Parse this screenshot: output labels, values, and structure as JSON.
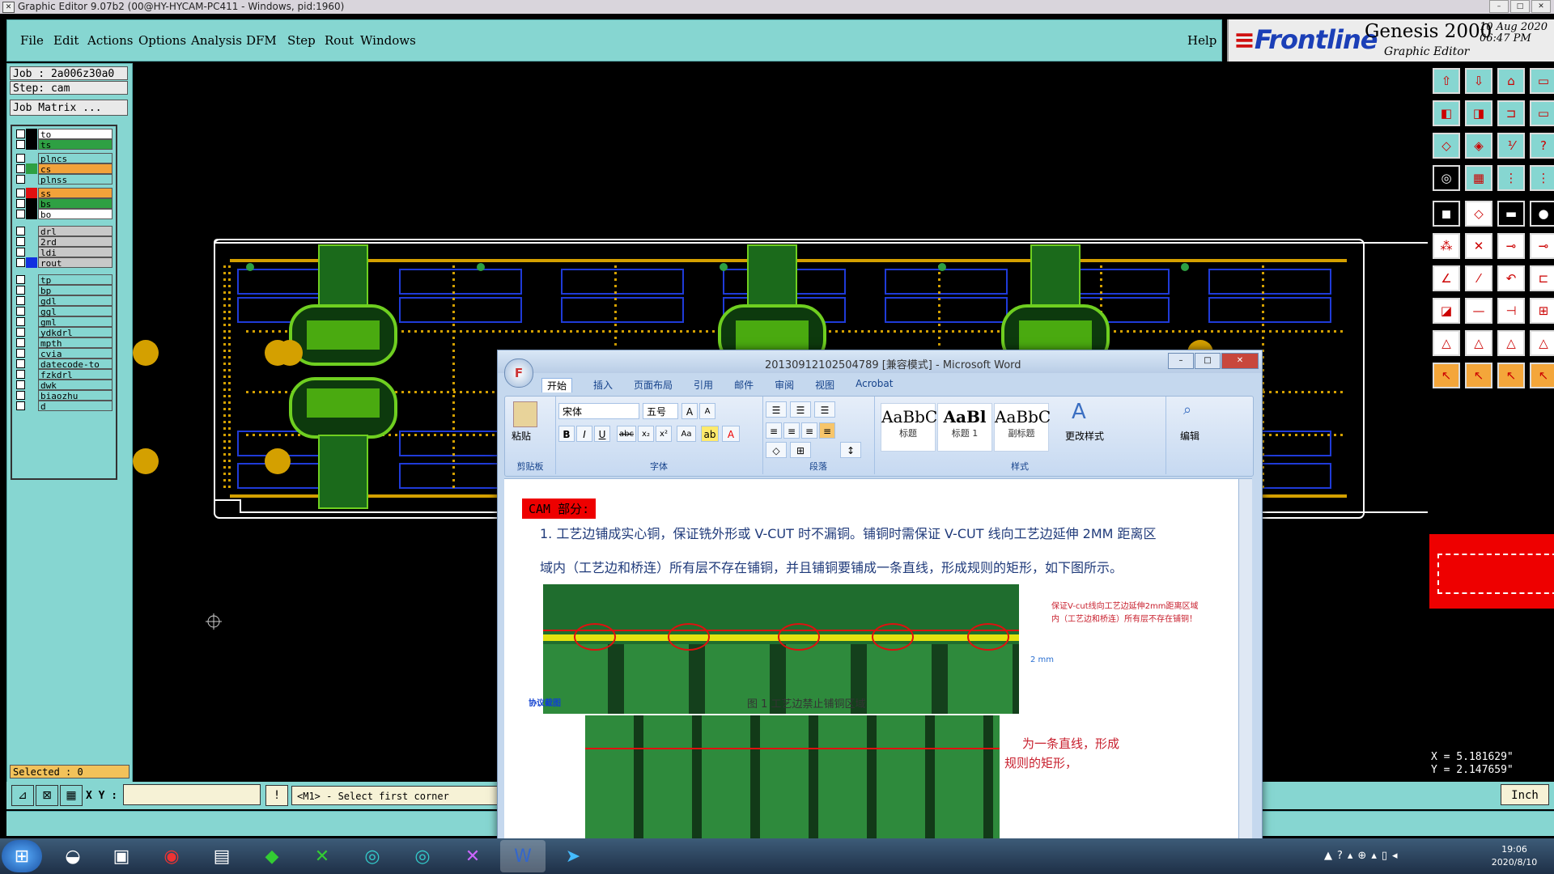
{
  "window_title": "Graphic Editor 9.07b2 (00@HY-HYCAM-PC411 - Windows, pid:1960)",
  "menu": {
    "items": [
      "File",
      "Edit",
      "Actions",
      "Options",
      "Analysis",
      "DFM",
      "Step",
      "Rout",
      "Windows"
    ],
    "help": "Help"
  },
  "brand": {
    "logo": "Frontline",
    "product": "Genesis 2000",
    "subtitle": "Graphic Editor",
    "date": "10 Aug 2020",
    "time": "06:47 PM"
  },
  "job": {
    "job": "Job : 2a006z30a0",
    "step": "Step: cam",
    "matrix": "Job Matrix ..."
  },
  "layers": [
    {
      "name": "to",
      "color": "#ffffff",
      "swatch": "#000000"
    },
    {
      "name": "ts",
      "color": "#2ea043",
      "swatch": "#000000"
    },
    {
      "name": "plncs",
      "color": "#86d6d1",
      "swatch": ""
    },
    {
      "name": "cs",
      "color": "#f2a23a",
      "swatch": "#2ea043"
    },
    {
      "name": "plnss",
      "color": "#86d6d1",
      "swatch": ""
    },
    {
      "name": "ss",
      "color": "#f2a23a",
      "swatch": "#e01010"
    },
    {
      "name": "bs",
      "color": "#2ea043",
      "swatch": "#000000"
    },
    {
      "name": "bo",
      "color": "#ffffff",
      "swatch": "#000000"
    },
    {
      "name": "drl",
      "color": "#c8c8c8",
      "swatch": ""
    },
    {
      "name": "2rd",
      "color": "#c8c8c8",
      "swatch": ""
    },
    {
      "name": "ldi",
      "color": "#c8c8c8",
      "swatch": ""
    },
    {
      "name": "rout",
      "color": "#c8c8c8",
      "swatch": "#1030e0"
    },
    {
      "name": "tp",
      "color": "#86d6d1",
      "swatch": ""
    },
    {
      "name": "bp",
      "color": "#86d6d1",
      "swatch": ""
    },
    {
      "name": "gdl",
      "color": "#86d6d1",
      "swatch": ""
    },
    {
      "name": "ggl",
      "color": "#86d6d1",
      "swatch": ""
    },
    {
      "name": "gml",
      "color": "#86d6d1",
      "swatch": ""
    },
    {
      "name": "ydkdrl",
      "color": "#86d6d1",
      "swatch": ""
    },
    {
      "name": "mpth",
      "color": "#86d6d1",
      "swatch": ""
    },
    {
      "name": "cvia",
      "color": "#86d6d1",
      "swatch": ""
    },
    {
      "name": "datecode-to",
      "color": "#86d6d1",
      "swatch": ""
    },
    {
      "name": "fzkdrl",
      "color": "#86d6d1",
      "swatch": ""
    },
    {
      "name": "dwk",
      "color": "#86d6d1",
      "swatch": ""
    },
    {
      "name": "biaozhu",
      "color": "#86d6d1",
      "swatch": ""
    },
    {
      "name": "d",
      "color": "#86d6d1",
      "swatch": ""
    }
  ],
  "selected": "Selected : 0",
  "coords": {
    "x": "X = 5.181629\"",
    "y": "Y = 2.147659\""
  },
  "bottom": {
    "xy_label": "X Y :",
    "prompt": "<M1> - Select first corner",
    "units": "Inch"
  },
  "word": {
    "title": "20130912102504789 [兼容模式] - Microsoft Word",
    "tabs": [
      "开始",
      "插入",
      "页面布局",
      "引用",
      "邮件",
      "审阅",
      "视图",
      "Acrobat"
    ],
    "groups": {
      "clipboard": "剪贴板",
      "font": "字体",
      "paragraph": "段落",
      "styles": "样式"
    },
    "paste": "粘贴",
    "font_name": "宋体",
    "font_size": "五号",
    "styles": [
      {
        "sample": "AaBbC",
        "name": "标题"
      },
      {
        "sample": "AaBl",
        "name": "标题 1"
      },
      {
        "sample": "AaBbC",
        "name": "副标题"
      }
    ],
    "change_style": "更改样式",
    "edit": "编辑",
    "heading": "CAM 部分:",
    "para1": "1.  工艺边铺成实心铜，保证铣外形或 V-CUT 时不漏铜。铺铜时需保证 V-CUT 线向工艺边延伸 2MM 距离区",
    "para2": "域内（工艺边和桥连）所有层不存在铺铜，并且铺铜要铺成一条直线，形成规则的矩形，如下图所示。",
    "note": "保证V-cut线向工艺边延伸2mm距离区域内（工艺边和桥连）所有层不存在铺铜！",
    "note_2mm": "2 mm",
    "caption": "图 1  工艺边禁止铺铜区域",
    "side_label": "协议截图",
    "red_caption1": "为一条直线，形成",
    "red_caption2": "规则的矩形，"
  },
  "clock": {
    "time": "19:06",
    "date": "2020/8/10"
  }
}
